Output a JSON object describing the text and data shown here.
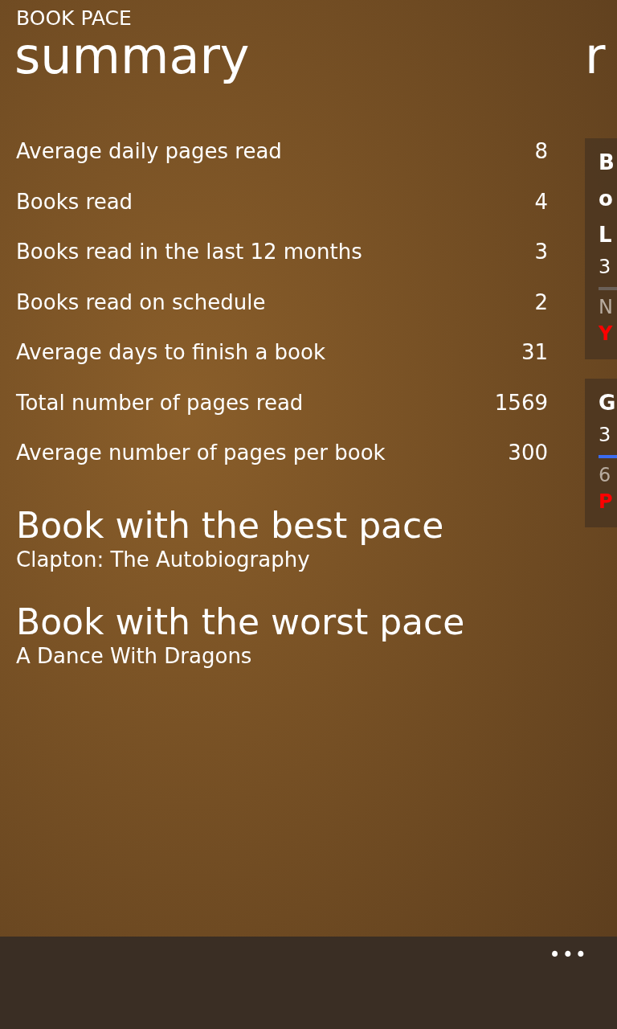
{
  "app_title": "BOOK PACE",
  "pivot": [
    {
      "title": "summary"
    },
    {
      "title": "r"
    }
  ],
  "stats": [
    {
      "label": "Average daily pages read",
      "value": "8"
    },
    {
      "label": "Books read",
      "value": "4"
    },
    {
      "label": "Books read in the last 12 months",
      "value": "3"
    },
    {
      "label": "Books read on schedule",
      "value": "2"
    },
    {
      "label": "Average days to finish a book",
      "value": "31"
    },
    {
      "label": "Total number of pages read",
      "value": "1569"
    },
    {
      "label": "Average number of pages per book",
      "value": "300"
    }
  ],
  "highlights": [
    {
      "heading": "Book with the best pace",
      "book": "Clapton: The Autobiography"
    },
    {
      "heading": "Book with the worst pace",
      "book": "A Dance With Dragons"
    }
  ],
  "cards": [
    {
      "title_lines": [
        "B",
        "o",
        "L"
      ],
      "date": "3",
      "color": "#6b6058",
      "pages": "N",
      "status": "Y"
    },
    {
      "title_lines": [
        "G"
      ],
      "date": "3",
      "color": "#3b6cf0",
      "pages": "6",
      "status": "P"
    }
  ],
  "app_bar": {
    "more": "•••"
  }
}
